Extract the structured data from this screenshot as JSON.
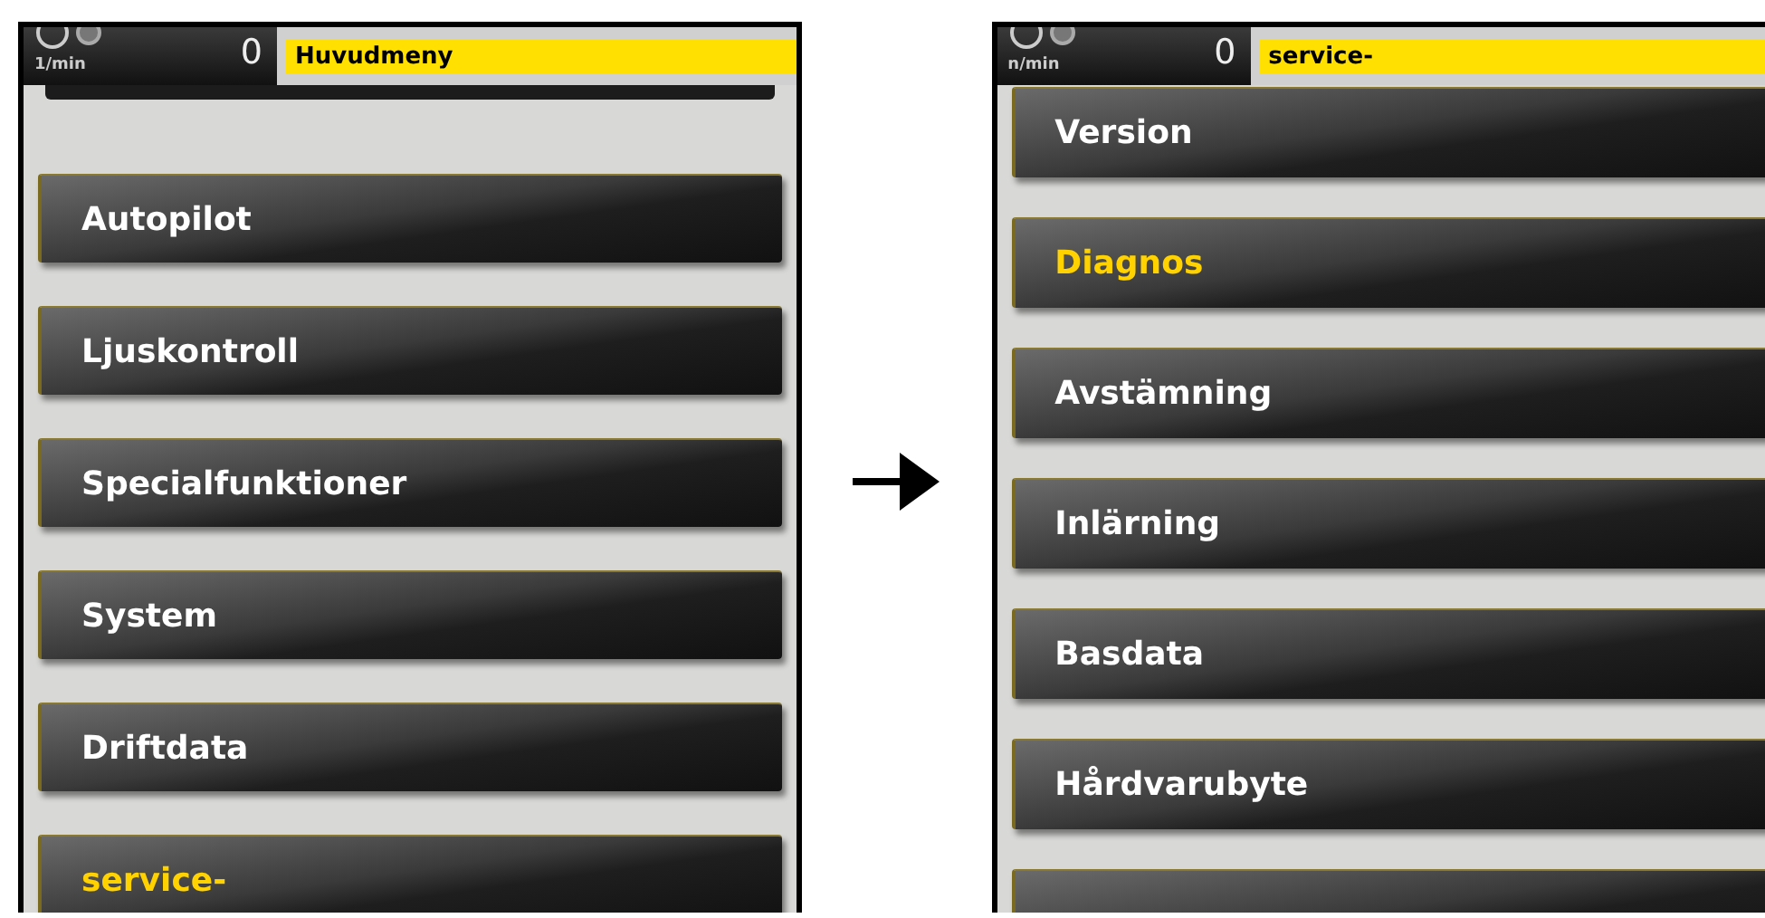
{
  "screens": [
    {
      "gauge": {
        "unit": "1/min",
        "value": "0"
      },
      "title": "Huvudmeny",
      "top_partial_bar": true,
      "bottom_partial_button": false,
      "items": [
        {
          "label": "Autopilot",
          "selected": false
        },
        {
          "label": "Ljuskontroll",
          "selected": false
        },
        {
          "label": "Specialfunktioner",
          "selected": false
        },
        {
          "label": "System",
          "selected": false
        },
        {
          "label": "Driftdata",
          "selected": false
        },
        {
          "label": "service-",
          "selected": true
        }
      ]
    },
    {
      "gauge": {
        "unit": "n/min",
        "value": "0"
      },
      "title": "service-",
      "top_partial_bar": false,
      "bottom_partial_button": true,
      "items": [
        {
          "label": "Version",
          "selected": false
        },
        {
          "label": "Diagnos",
          "selected": true
        },
        {
          "label": "Avstämning",
          "selected": false
        },
        {
          "label": "Inlärning",
          "selected": false
        },
        {
          "label": "Basdata",
          "selected": false
        },
        {
          "label": "Hårdvarubyte",
          "selected": false
        }
      ]
    }
  ]
}
